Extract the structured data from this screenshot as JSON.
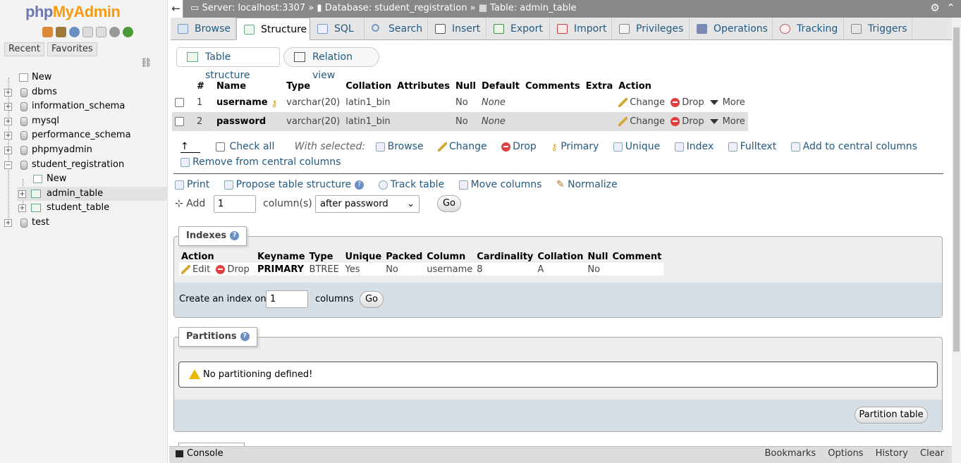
{
  "app": {
    "logo_a": "php",
    "logo_b": "MyAdmin"
  },
  "nav": {
    "recent": "Recent",
    "favorites": "Favorites"
  },
  "tree": [
    {
      "label": "New"
    },
    {
      "label": "dbms"
    },
    {
      "label": "information_schema"
    },
    {
      "label": "mysql"
    },
    {
      "label": "performance_schema"
    },
    {
      "label": "phpmyadmin"
    },
    {
      "label": "student_registration"
    },
    {
      "label": "New"
    },
    {
      "label": "admin_table"
    },
    {
      "label": "student_table"
    },
    {
      "label": "test"
    }
  ],
  "breadcrumb": {
    "server": "Server: localhost:3307",
    "database": "Database: student_registration",
    "table": "Table: admin_table",
    "sep": "»"
  },
  "tabs": [
    "Browse",
    "Structure",
    "SQL",
    "Search",
    "Insert",
    "Export",
    "Import",
    "Privileges",
    "Operations",
    "Tracking",
    "Triggers"
  ],
  "subtabs": {
    "structure": "Table structure",
    "relation": "Relation view"
  },
  "columns_table": {
    "headers": [
      "#",
      "Name",
      "Type",
      "Collation",
      "Attributes",
      "Null",
      "Default",
      "Comments",
      "Extra",
      "Action"
    ],
    "rows": [
      {
        "num": "1",
        "name": "username",
        "type": "varchar(20)",
        "collation": "latin1_bin",
        "null": "No",
        "default": "None"
      },
      {
        "num": "2",
        "name": "password",
        "type": "varchar(20)",
        "collation": "latin1_bin",
        "null": "No",
        "default": "None"
      }
    ],
    "change": "Change",
    "drop": "Drop",
    "more": "More"
  },
  "with_selected": {
    "check_all": "Check all",
    "label": "With selected:",
    "browse": "Browse",
    "change": "Change",
    "drop": "Drop",
    "primary": "Primary",
    "unique": "Unique",
    "index": "Index",
    "fulltext": "Fulltext",
    "add_central": "Add to central columns",
    "remove_central": "Remove from central columns"
  },
  "tools": {
    "print": "Print",
    "propose": "Propose table structure",
    "track": "Track table",
    "move": "Move columns",
    "normalize": "Normalize"
  },
  "add_cols": {
    "add": "Add",
    "value": "1",
    "columns": "column(s)",
    "position": "after password",
    "go": "Go"
  },
  "indexes": {
    "legend": "Indexes",
    "headers": [
      "Action",
      "Keyname",
      "Type",
      "Unique",
      "Packed",
      "Column",
      "Cardinality",
      "Collation",
      "Null",
      "Comment"
    ],
    "row": {
      "edit": "Edit",
      "drop": "Drop",
      "keyname": "PRIMARY",
      "type": "BTREE",
      "unique": "Yes",
      "packed": "No",
      "column": "username",
      "cardinality": "8",
      "collation": "A",
      "null": "No",
      "comment": ""
    },
    "create_label": "Create an index on",
    "create_value": "1",
    "columns": "columns",
    "go": "Go"
  },
  "partitions": {
    "legend": "Partitions",
    "notice": "No partitioning defined!",
    "button": "Partition table"
  },
  "console": {
    "label": "Console",
    "bookmarks": "Bookmarks",
    "options": "Options",
    "history": "History",
    "clear": "Clear"
  }
}
